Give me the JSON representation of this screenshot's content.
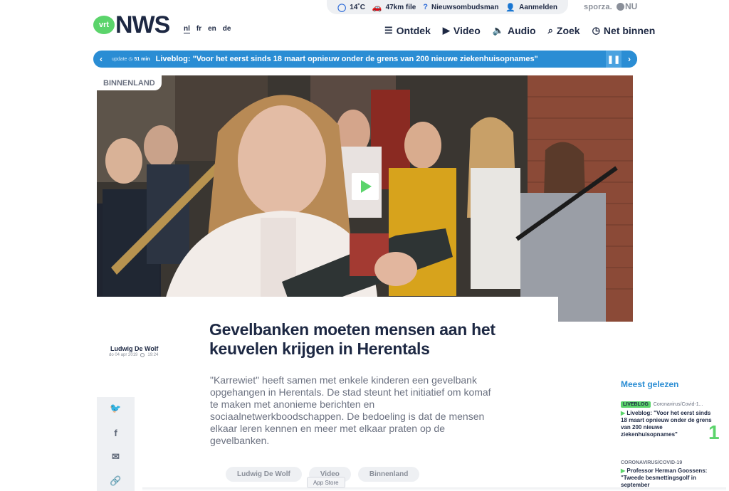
{
  "utility": {
    "weather": "14˚C",
    "traffic": "47km file",
    "ombudsman": "Nieuwsombudsman",
    "login": "Aanmelden"
  },
  "brands": {
    "sporza": "sporza.",
    "vrtnu": "NU"
  },
  "logo": {
    "vrt": "vrt",
    "nws": "NWS"
  },
  "languages": [
    "nl",
    "fr",
    "en",
    "de"
  ],
  "nav": {
    "ontdek": "Ontdek",
    "video": "Video",
    "audio": "Audio",
    "zoek": "Zoek",
    "netbinnen": "Net binnen"
  },
  "ticker": {
    "update_label": "update",
    "update_time": "51 min",
    "headline": "Liveblog: \"Voor het eerst sinds 18 maart opnieuw onder de grens van 200 nieuwe ziekenhuisopnames\""
  },
  "hero": {
    "category": "BINNENLAND"
  },
  "article": {
    "author": "Ludwig De Wolf",
    "date": "do 04 apr 2019",
    "time": "19:24",
    "title": "Gevelbanken moeten mensen aan het keuvelen krijgen in Herentals",
    "intro": "\"Karrewiet\" heeft samen met enkele kinderen een gevelbank opgehangen in Herentals. De stad steunt het initiatief om komaf te maken met anonieme berichten en sociaalnetwerkboodschappen. De bedoeling is dat de mensen elkaar leren kennen en meer met elkaar praten op de gevelbanken.",
    "tags": [
      "Ludwig De Wolf",
      "Video",
      "Binnenland"
    ]
  },
  "overlay": {
    "appstore": "App Store"
  },
  "sidebar": {
    "title": "Meest gelezen",
    "items": [
      {
        "badge": "LIVEBLOG",
        "category": "Coronavirus/Covid-1...",
        "headline": "Liveblog: \"Voor het eerst sinds 18 maart opnieuw onder de grens van 200 nieuwe ziekenhuisopnames\"",
        "rank": "1"
      },
      {
        "category": "CORONAVIRUS/COVID-19",
        "headline": "Professor Herman Goossens: \"Tweede besmettingsgolf in september"
      }
    ]
  },
  "colors": {
    "green": "#5bd46b",
    "blue": "#2a8dd4",
    "navy": "#1d2843"
  }
}
